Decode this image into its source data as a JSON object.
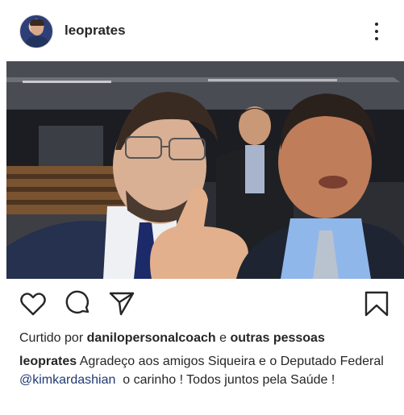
{
  "post": {
    "username": "leoprates",
    "likes": {
      "prefix": "Curtido por",
      "user": "danilopersonalcoach",
      "joiner": "e",
      "others": "outras pessoas"
    },
    "caption": {
      "author": "leoprates",
      "text_1": "Agradeço aos amigos Siqueira e o Deputado Federal",
      "mention": "@kimkardashian",
      "text_2": "o carinho ! Todos juntos pela Saúde !"
    }
  },
  "icons": {
    "more": "more-vertical-icon",
    "like": "heart-icon",
    "comment": "comment-bubble-icon",
    "share": "paper-plane-icon",
    "save": "bookmark-icon",
    "mute": "speaker-muted-icon"
  },
  "colors": {
    "text": "#262626",
    "mention": "#1f3b73",
    "icon": "#262626"
  }
}
